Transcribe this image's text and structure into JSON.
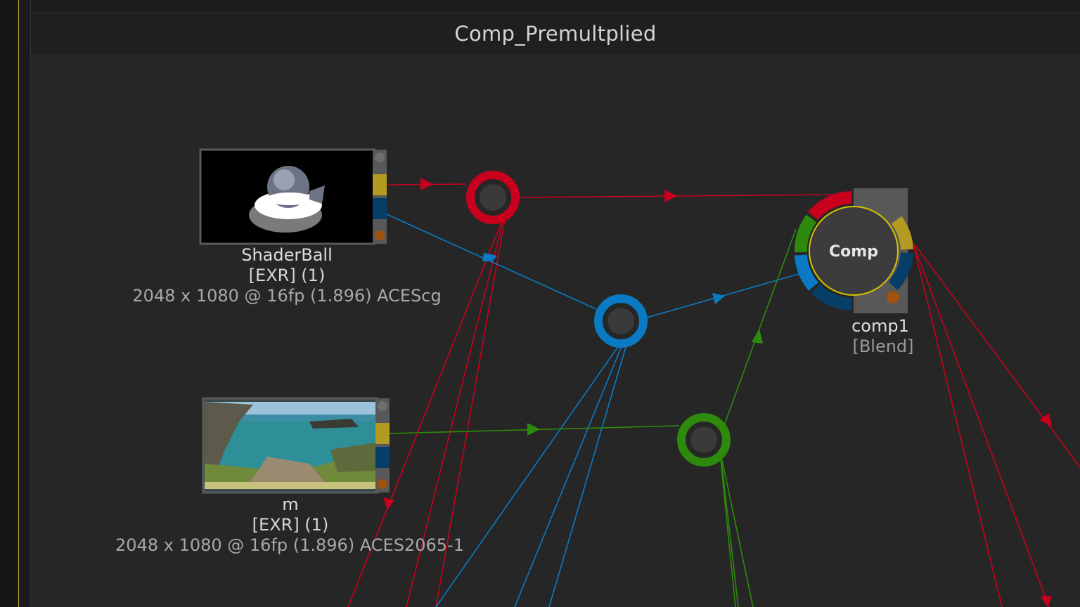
{
  "graph": {
    "title": "Comp_Premultplied"
  },
  "nodes": {
    "shaderball": {
      "name": "ShaderBall",
      "type": "[EXR] (1)",
      "info": "2048 x 1080 @ 16fp (1.896)  ACEScg"
    },
    "m": {
      "name": "m",
      "type": "[EXR] (1)",
      "info": "2048 x 1080 @ 16fp (1.896)  ACES2065-1"
    },
    "comp1": {
      "badge": "Comp",
      "name": "comp1",
      "type": "[Blend]"
    }
  },
  "colors": {
    "red_channel": "#c8001e",
    "green_channel": "#2e8a0c",
    "blue_channel": "#0a7ac4",
    "alpha_port": "#b39a22",
    "dark_blue_port": "#063e68",
    "orange_port": "#a0520f",
    "selection_outline": "#d4c400"
  },
  "icons": {
    "red_dot": "red-channel-dot-icon",
    "blue_dot": "blue-channel-dot-icon",
    "green_dot": "green-channel-dot-icon"
  }
}
